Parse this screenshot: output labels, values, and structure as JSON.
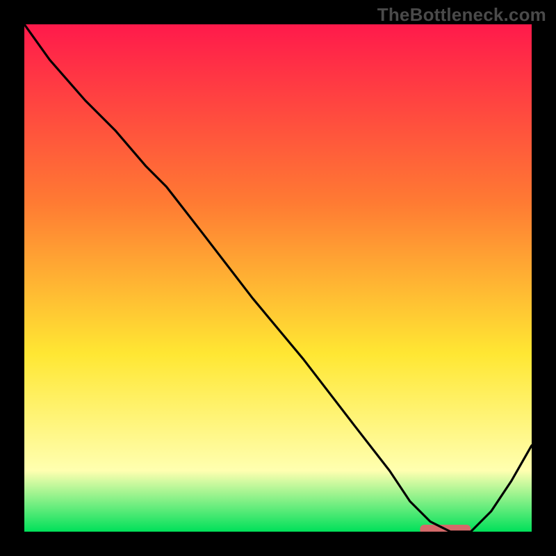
{
  "watermark": {
    "text": "TheBottleneck.com"
  },
  "colors": {
    "background": "#000000",
    "watermark_text": "#4a4a4a",
    "curve": "#000000",
    "optimum_marker": "#d46a6a",
    "gradient": {
      "top": "#ff1a4b",
      "orange": "#ff7a33",
      "yellow": "#ffe733",
      "pale_yellow": "#ffffb0",
      "green": "#00e05a"
    }
  },
  "chart_data": {
    "type": "line",
    "title": "",
    "xlabel": "",
    "ylabel": "",
    "xlim": [
      0,
      100
    ],
    "ylim": [
      0,
      100
    ],
    "curve": {
      "name": "bottleneck-curve",
      "x": [
        0,
        5,
        12,
        18,
        24,
        28,
        35,
        45,
        55,
        65,
        72,
        76,
        80,
        84,
        88,
        92,
        96,
        100
      ],
      "y": [
        100,
        93,
        85,
        79,
        72,
        68,
        59,
        46,
        34,
        21,
        12,
        6,
        2,
        0,
        0,
        4,
        10,
        17
      ]
    },
    "optimum_band": {
      "x_start": 78,
      "x_end": 88,
      "y": 0
    }
  }
}
